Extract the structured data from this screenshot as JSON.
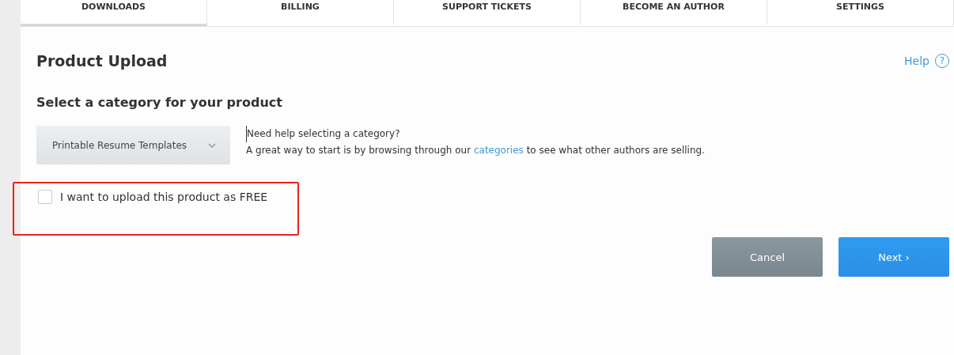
{
  "tabs": [
    {
      "label": "DOWNLOADS",
      "selected": true
    },
    {
      "label": "BILLING",
      "selected": false
    },
    {
      "label": "SUPPORT TICKETS",
      "selected": false
    },
    {
      "label": "BECOME AN AUTHOR",
      "selected": false
    },
    {
      "label": "SETTINGS",
      "selected": false
    }
  ],
  "page_title": "Product Upload",
  "help_link": {
    "label": "Help",
    "icon": "?"
  },
  "section_title": "Select a category for your product",
  "category_select": {
    "value": "Printable Resume Templates"
  },
  "help_text": {
    "question": "Need help selecting a category?",
    "sentence_before": "A great way to start is by browsing through our",
    "link": "categories",
    "sentence_after": "to see what other authors are selling."
  },
  "free_checkbox": {
    "label": "I want to upload this product as FREE",
    "checked": false,
    "highlighted": true
  },
  "buttons": [
    {
      "kind": "secondary",
      "label": "Cancel"
    },
    {
      "kind": "primary",
      "label": "Next",
      "icon": "›"
    }
  ]
}
